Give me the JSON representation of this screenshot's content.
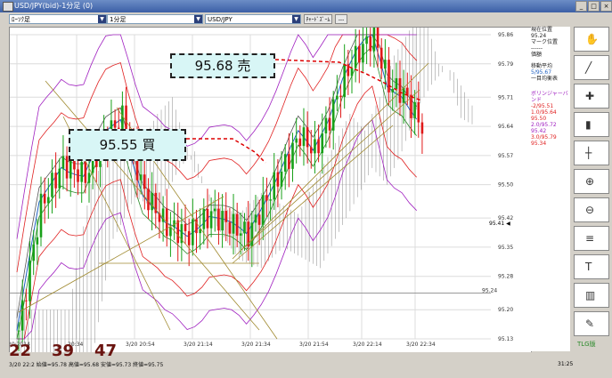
{
  "window": {
    "title": "USD/JPY(bid)-1分足 (0)"
  },
  "toolbar": {
    "combo1": "ﾛｰｿｸ足",
    "combo2": "1分足",
    "combo3": "USD/JPY",
    "btn1": "ﾁｬｰﾄﾞｽﾞｰﾑ",
    "btn2": "---"
  },
  "callouts": {
    "sell": "95.68 売",
    "buy": "95.55 買"
  },
  "price_axis": [
    "95.86",
    "95.79",
    "95.71",
    "95.64",
    "95.57",
    "95.50",
    "95.42",
    "95.35",
    "95.28",
    "95.20",
    "95.13"
  ],
  "price_markers": {
    "current": "95.41",
    "level": "95.24"
  },
  "time_axis": [
    "20:34",
    "3/20 20:54",
    "3/20 21:14",
    "3/20 21:34",
    "3/20 21:54",
    "3/20 22:14",
    "3/20 22:34"
  ],
  "time_axis_left": "20:2014",
  "side_panel": {
    "l1": "現在位置",
    "l2": "95.24",
    "l3": "マーク位置",
    "l4": "------",
    "l5": "価額",
    "l6": "移動平均",
    "l7": "5/95.67",
    "l8": "一目均衡表",
    "l9": "ボリンジャーバンド",
    "l10": "-2/95.51",
    "l11": "1.0/95.64 95.50",
    "l12": "2.0/95.72 95.42",
    "l13": "3.0/95.79 95.34"
  },
  "status": {
    "big_numbers": [
      "22",
      "39",
      "47"
    ],
    "line": "3/20 22:2   始値=95.78 高値=95.68 安値=95.73 終値=95.75",
    "right_value": "31:25",
    "fx_label": "TLG版"
  },
  "colors": {
    "candle_up": "#18a018",
    "candle_down": "#e01818",
    "bollinger": "#e02020",
    "bollinger_outer": "#a020c0",
    "ma": "#2060c0",
    "trend": "#a08a30",
    "cloud": "#888888"
  }
}
